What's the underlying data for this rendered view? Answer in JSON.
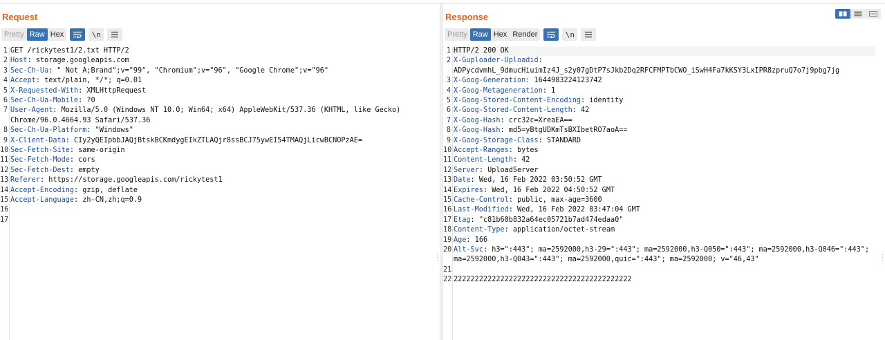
{
  "request": {
    "title": "Request",
    "tabs": [
      "Pretty",
      "Raw",
      "Hex"
    ],
    "active_tab": "Raw",
    "newline_label": "\\n",
    "lines": [
      {
        "n": "1",
        "text": "GET /rickytest1/2.txt HTTP/2"
      },
      {
        "n": "2",
        "key": "Host",
        "val": " storage.googleapis.com"
      },
      {
        "n": "3",
        "key": "Sec-Ch-Ua",
        "val": " \" Not A;Brand\";v=\"99\", \"Chromium\";v=\"96\", \"Google Chrome\";v=\"96\""
      },
      {
        "n": "4",
        "key": "Accept",
        "val": " text/plain, */*; q=0.01"
      },
      {
        "n": "5",
        "key": "X-Requested-With",
        "val": " XMLHttpRequest"
      },
      {
        "n": "6",
        "key": "Sec-Ch-Ua-Mobile",
        "val": " ?0"
      },
      {
        "n": "7",
        "key": "User-Agent",
        "val": " Mozilla/5.0 (Windows NT 10.0; Win64; x64) AppleWebKit/537.36 (KHTML, like Gecko)"
      },
      {
        "n": "",
        "text": "Chrome/96.0.4664.93 Safari/537.36"
      },
      {
        "n": "8",
        "key": "Sec-Ch-Ua-Platform",
        "val": " \"Windows\""
      },
      {
        "n": "9",
        "key": "X-Client-Data",
        "val": " CIy2yQEIpbbJAQjBtskBCKmdygEIkZTLAQjr8ssBCJ75ywEI54TMAQjLicwBCNOPzAE="
      },
      {
        "n": "10",
        "key": "Sec-Fetch-Site",
        "val": " same-origin"
      },
      {
        "n": "11",
        "key": "Sec-Fetch-Mode",
        "val": " cors"
      },
      {
        "n": "12",
        "key": "Sec-Fetch-Dest",
        "val": " empty"
      },
      {
        "n": "13",
        "key": "Referer",
        "val": " https://storage.googleapis.com/rickytest1"
      },
      {
        "n": "14",
        "key": "Accept-Encoding",
        "val": " gzip, deflate"
      },
      {
        "n": "15",
        "key": "Accept-Language",
        "val": " zh-CN,zh;q=0.9"
      },
      {
        "n": "16",
        "text": ""
      },
      {
        "n": "17",
        "text": ""
      }
    ]
  },
  "response": {
    "title": "Response",
    "tabs": [
      "Pretty",
      "Raw",
      "Hex",
      "Render"
    ],
    "active_tab": "Raw",
    "newline_label": "\\n",
    "lines": [
      {
        "n": "1",
        "text": "HTTP/2 200 OK"
      },
      {
        "n": "2",
        "key": "X-Guploader-Uploadid",
        "val": ""
      },
      {
        "n": "",
        "text": "ADPycdvmhL_9dmucHiuimIz4J_s2y07gDtP7sJkb2Dq2RFCFMPTbCWO_iSwH4Fa7kKSY3LxIPR8zpruQ7o7j9pbg7jg"
      },
      {
        "n": "3",
        "key": "X-Goog-Generation",
        "val": " 1644983224123742"
      },
      {
        "n": "4",
        "key": "X-Goog-Metageneration",
        "val": " 1"
      },
      {
        "n": "5",
        "key": "X-Goog-Stored-Content-Encoding",
        "val": " identity"
      },
      {
        "n": "6",
        "key": "X-Goog-Stored-Content-Length",
        "val": " 42"
      },
      {
        "n": "7",
        "key": "X-Goog-Hash",
        "val": " crc32c=XreaEA=="
      },
      {
        "n": "8",
        "key": "X-Goog-Hash",
        "val": " md5=yBtgUDKmTsBXIbetRO7aoA=="
      },
      {
        "n": "9",
        "key": "X-Goog-Storage-Class",
        "val": " STANDARD"
      },
      {
        "n": "10",
        "key": "Accept-Ranges",
        "val": " bytes"
      },
      {
        "n": "11",
        "key": "Content-Length",
        "val": " 42"
      },
      {
        "n": "12",
        "key": "Server",
        "val": " UploadServer"
      },
      {
        "n": "13",
        "key": "Date",
        "val": " Wed, 16 Feb 2022 03:50:52 GMT"
      },
      {
        "n": "14",
        "key": "Expires",
        "val": " Wed, 16 Feb 2022 04:50:52 GMT"
      },
      {
        "n": "15",
        "key": "Cache-Control",
        "val": " public, max-age=3600"
      },
      {
        "n": "16",
        "key": "Last-Modified",
        "val": " Wed, 16 Feb 2022 03:47:04 GMT"
      },
      {
        "n": "17",
        "key": "Etag",
        "val": " \"c81b60b832a64ec05721b7ad474edaa0\""
      },
      {
        "n": "18",
        "key": "Content-Type",
        "val": " application/octet-stream"
      },
      {
        "n": "19",
        "key": "Age",
        "val": " 166"
      },
      {
        "n": "20",
        "key": "Alt-Svc",
        "val": " h3=\":443\"; ma=2592000,h3-29=\":443\"; ma=2592000,h3-Q050=\":443\"; ma=2592000,h3-Q046=\":443\";"
      },
      {
        "n": "",
        "text": "ma=2592000,h3-Q043=\":443\"; ma=2592000,quic=\":443\"; ma=2592000; v=\"46,43\""
      },
      {
        "n": "21",
        "text": ""
      },
      {
        "n": "22",
        "text": "222222222222222222222222222222222222222222"
      }
    ]
  },
  "colors": {
    "accent": "#e8621f",
    "active_button": "#3673b5",
    "header_key": "#1a4fa3"
  },
  "view_layout_icons": [
    "side-by-side-layout-icon",
    "stacked-layout-icon",
    "single-pane-layout-icon"
  ]
}
